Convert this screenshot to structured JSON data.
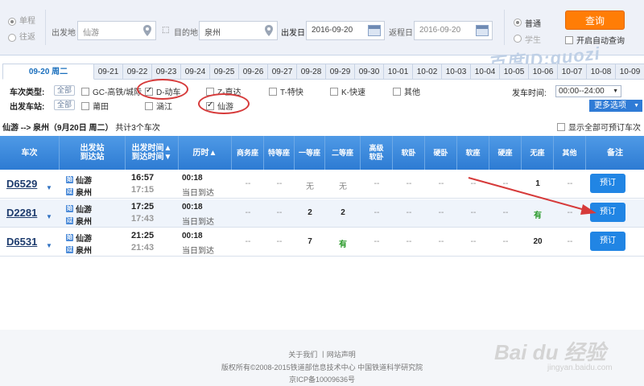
{
  "search": {
    "trip_types": [
      {
        "label": "单程",
        "selected": true
      },
      {
        "label": "往返",
        "selected": false
      }
    ],
    "from_label": "出发地",
    "from_value": "仙游",
    "to_label": "目的地",
    "to_value": "泉州",
    "depart_date_label": "出发日",
    "depart_date": "2016-09-20",
    "return_date_label": "返程日",
    "return_date": "2016-09-20",
    "train_types": [
      {
        "label": "普通",
        "selected": true
      },
      {
        "label": "学生",
        "selected": false
      }
    ],
    "query_label": "查询",
    "auto_query_label": "开启自动查询"
  },
  "date_tabs": [
    "09-20 周二",
    "09-21",
    "09-22",
    "09-23",
    "09-24",
    "09-25",
    "09-26",
    "09-27",
    "09-28",
    "09-29",
    "09-30",
    "10-01",
    "10-02",
    "10-03",
    "10-04",
    "10-05",
    "10-06",
    "10-07",
    "10-08",
    "10-09"
  ],
  "filters": {
    "type_label": "车次类型:",
    "all_label": "全部",
    "types": [
      {
        "label": "GC-高铁/城际",
        "checked": false
      },
      {
        "label": "D-动车",
        "checked": true
      },
      {
        "label": "Z-直达",
        "checked": false
      },
      {
        "label": "T-特快",
        "checked": false
      },
      {
        "label": "K-快速",
        "checked": false
      },
      {
        "label": "其他",
        "checked": false
      }
    ],
    "station_label": "出发车站:",
    "stations": [
      {
        "label": "莆田",
        "checked": false
      },
      {
        "label": "涵江",
        "checked": false
      },
      {
        "label": "仙游",
        "checked": true
      }
    ],
    "time_label": "发车时间:",
    "time_value": "00:00--24:00",
    "more_label": "更多选项"
  },
  "summary": {
    "route": "仙游 --> 泉州（9月20日 周二）",
    "count": "共计3个车次"
  },
  "show_all_label": "显示全部可预订车次",
  "table": {
    "headers": [
      "车次",
      "出发站\n到达站",
      "出发时间▲\n到达时间▼",
      "历时▲",
      "商务座",
      "特等座",
      "一等座",
      "二等座",
      "高级\n软卧",
      "软卧",
      "硬卧",
      "软座",
      "硬座",
      "无座",
      "其他",
      "备注"
    ],
    "rows": [
      {
        "code": "D6529",
        "from": "仙游",
        "to": "泉州",
        "dep": "16:57",
        "arr": "17:15",
        "duration": "00:18",
        "note": "当日到达",
        "seats": [
          "--",
          "--",
          "无",
          "无",
          "--",
          "--",
          "--",
          "--",
          "--",
          "1",
          "--"
        ],
        "book": "预订"
      },
      {
        "code": "D2281",
        "from": "仙游",
        "to": "泉州",
        "dep": "17:25",
        "arr": "17:43",
        "duration": "00:18",
        "note": "当日到达",
        "seats": [
          "--",
          "--",
          "2",
          "2",
          "--",
          "--",
          "--",
          "--",
          "--",
          "有",
          "--"
        ],
        "book": "预订"
      },
      {
        "code": "D6531",
        "from": "仙游",
        "to": "泉州",
        "dep": "21:25",
        "arr": "21:43",
        "duration": "00:18",
        "note": "当日到达",
        "seats": [
          "--",
          "--",
          "7",
          "有",
          "--",
          "--",
          "--",
          "--",
          "--",
          "20",
          "--"
        ],
        "book": "预订"
      }
    ]
  },
  "footer": {
    "links": "关于我们 丨网站声明",
    "copyright": "版权所有©2008-2015铁道部信息技术中心  中国铁道科学研究院",
    "icp": "京ICP备10009636号"
  },
  "watermarks": {
    "top": "百度ID:guozi",
    "bottom": "Bai du 经验",
    "bottom_sub": "jingyan.baidu.com"
  },
  "colors": {
    "accent": "#2d7bd3",
    "query_button": "#ff7d06",
    "highlight_circle": "#d63a3a",
    "available": "#2a9a2a"
  }
}
